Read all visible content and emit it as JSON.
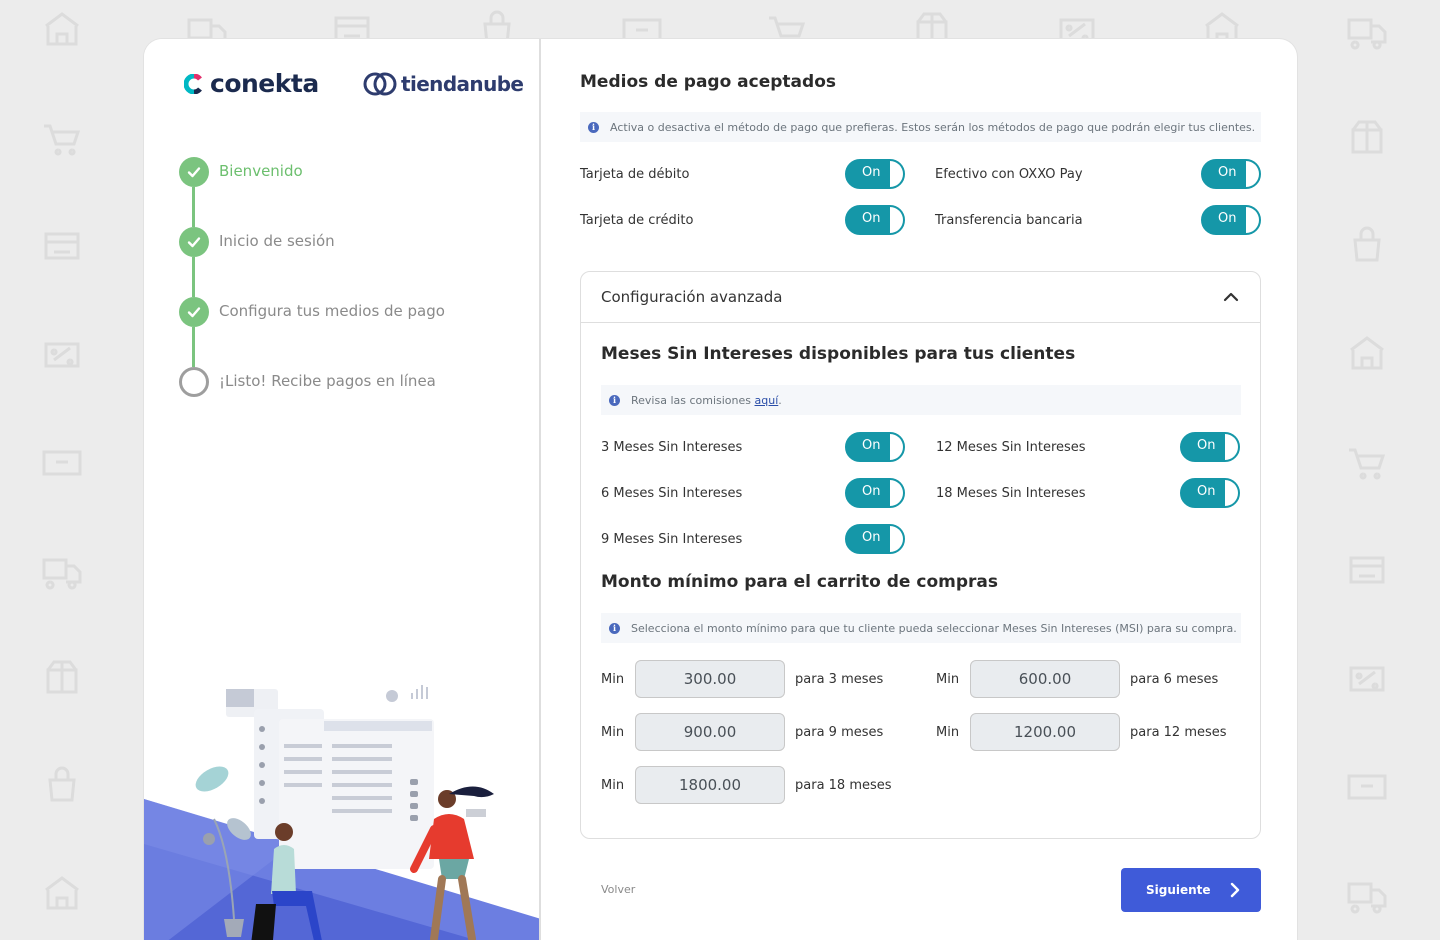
{
  "brand": {
    "conekta": "conekta",
    "tiendanube": "tiendanube",
    "colors": {
      "accent_green": "#7bc47f",
      "toggle_teal": "#1597a8",
      "primary_blue": "#3f5bd9"
    }
  },
  "steps": [
    {
      "label": "Bienvenido",
      "state": "done",
      "active": true
    },
    {
      "label": "Inicio de sesión",
      "state": "done",
      "active": false
    },
    {
      "label": "Configura tus medios de pago",
      "state": "done",
      "active": false
    },
    {
      "label": "¡Listo! Recibe pagos en línea",
      "state": "pending",
      "active": false
    }
  ],
  "payment": {
    "title": "Medios de pago aceptados",
    "info": "Activa o desactiva el método de pago que prefieras. Estos serán los métodos de pago que podrán elegir tus clientes.",
    "methods": [
      {
        "label": "Tarjeta de débito",
        "toggle": "On"
      },
      {
        "label": "Efectivo con OXXO Pay",
        "toggle": "On"
      },
      {
        "label": "Tarjeta de crédito",
        "toggle": "On"
      },
      {
        "label": "Transferencia bancaria",
        "toggle": "On"
      }
    ]
  },
  "advanced": {
    "title": "Configuración avanzada",
    "msi_title": "Meses Sin Intereses disponibles para tus clientes",
    "msi_info_prefix": "Revisa las comisiones ",
    "msi_info_link": "aquí",
    "msi_info_suffix": ".",
    "msi_options": [
      {
        "label": "3 Meses Sin Intereses",
        "toggle": "On"
      },
      {
        "label": "12 Meses Sin Intereses",
        "toggle": "On"
      },
      {
        "label": "6 Meses Sin Intereses",
        "toggle": "On"
      },
      {
        "label": "18 Meses Sin Intereses",
        "toggle": "On"
      },
      {
        "label": "9 Meses Sin Intereses",
        "toggle": "On"
      }
    ],
    "min_title": "Monto mínimo para el carrito de compras",
    "min_info": "Selecciona el monto mínimo para que tu cliente pueda seleccionar Meses Sin Intereses (MSI) para su compra.",
    "min_prefix": "Min",
    "minimums": [
      {
        "value": "300.00",
        "suffix": "para 3 meses"
      },
      {
        "value": "600.00",
        "suffix": "para 6 meses"
      },
      {
        "value": "900.00",
        "suffix": "para 9 meses"
      },
      {
        "value": "1200.00",
        "suffix": "para 12 meses"
      },
      {
        "value": "1800.00",
        "suffix": "para 18 meses"
      }
    ]
  },
  "footer": {
    "back": "Volver",
    "next": "Siguiente"
  }
}
